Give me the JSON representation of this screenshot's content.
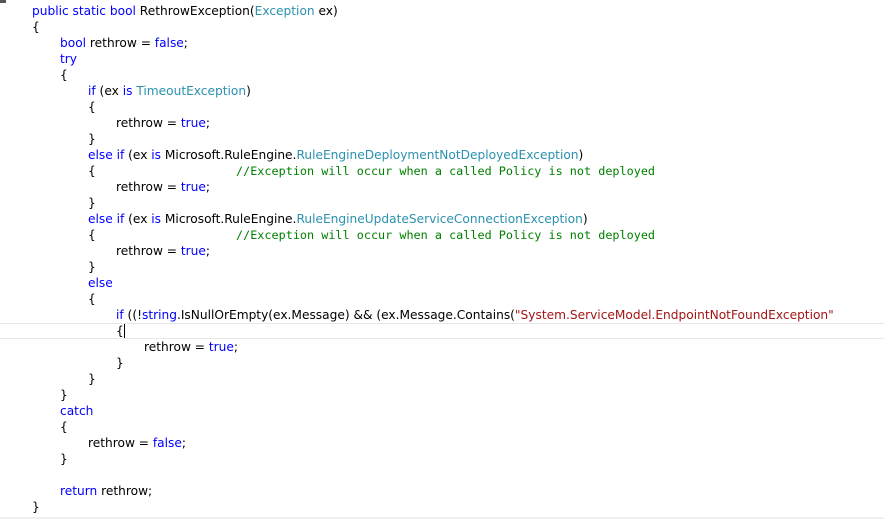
{
  "editor": {
    "colors": {
      "background": "#ffffff",
      "keyword": "#0000ff",
      "type": "#2b91af",
      "comment": "#008000",
      "string": "#a31515",
      "plain": "#000000"
    },
    "lines": [
      {
        "segs": [
          {
            "t": "public",
            "c": "keyword"
          },
          {
            "t": " "
          },
          {
            "t": "static",
            "c": "keyword"
          },
          {
            "t": " "
          },
          {
            "t": "bool",
            "c": "keyword"
          },
          {
            "t": " RethrowException("
          },
          {
            "t": "Exception",
            "c": "type"
          },
          {
            "t": " ex)"
          }
        ]
      },
      {
        "segs": [
          {
            "t": "{"
          }
        ]
      },
      {
        "segs": [
          {
            "t": "bool",
            "c": "keyword"
          },
          {
            "t": " rethrow = "
          },
          {
            "t": "false",
            "c": "keyword"
          },
          {
            "t": ";"
          }
        ]
      },
      {
        "segs": [
          {
            "t": "try",
            "c": "keyword"
          }
        ]
      },
      {
        "segs": [
          {
            "t": "{"
          }
        ]
      },
      {
        "segs": [
          {
            "t": "if",
            "c": "keyword"
          },
          {
            "t": " (ex "
          },
          {
            "t": "is",
            "c": "keyword"
          },
          {
            "t": " "
          },
          {
            "t": "TimeoutException",
            "c": "type"
          },
          {
            "t": ")"
          }
        ]
      },
      {
        "segs": [
          {
            "t": "{"
          }
        ]
      },
      {
        "segs": [
          {
            "t": "rethrow = "
          },
          {
            "t": "true",
            "c": "keyword"
          },
          {
            "t": ";"
          }
        ]
      },
      {
        "segs": [
          {
            "t": "}"
          }
        ]
      },
      {
        "segs": [
          {
            "t": "else",
            "c": "keyword"
          },
          {
            "t": " "
          },
          {
            "t": "if",
            "c": "keyword"
          },
          {
            "t": " (ex "
          },
          {
            "t": "is",
            "c": "keyword"
          },
          {
            "t": " Microsoft.RuleEngine."
          },
          {
            "t": "RuleEngineDeploymentNotDeployedException",
            "c": "type"
          },
          {
            "t": ")"
          }
        ]
      },
      {
        "segs": [
          {
            "t": "{"
          }
        ],
        "comment": "//Exception will occur when a called Policy is not deployed"
      },
      {
        "segs": [
          {
            "t": "rethrow = "
          },
          {
            "t": "true",
            "c": "keyword"
          },
          {
            "t": ";"
          }
        ]
      },
      {
        "segs": [
          {
            "t": "}"
          }
        ]
      },
      {
        "segs": [
          {
            "t": "else",
            "c": "keyword"
          },
          {
            "t": " "
          },
          {
            "t": "if",
            "c": "keyword"
          },
          {
            "t": " (ex "
          },
          {
            "t": "is",
            "c": "keyword"
          },
          {
            "t": " Microsoft.RuleEngine."
          },
          {
            "t": "RuleEngineUpdateServiceConnectionException",
            "c": "type"
          },
          {
            "t": ")"
          }
        ]
      },
      {
        "segs": [
          {
            "t": "{"
          }
        ],
        "comment": "//Exception will occur when a called Policy is not deployed"
      },
      {
        "segs": [
          {
            "t": "rethrow = "
          },
          {
            "t": "true",
            "c": "keyword"
          },
          {
            "t": ";"
          }
        ]
      },
      {
        "segs": [
          {
            "t": "}"
          }
        ]
      },
      {
        "segs": [
          {
            "t": "else",
            "c": "keyword"
          }
        ]
      },
      {
        "segs": [
          {
            "t": "{"
          }
        ]
      },
      {
        "segs": [
          {
            "t": "if",
            "c": "keyword"
          },
          {
            "t": " ((!"
          },
          {
            "t": "string",
            "c": "keyword"
          },
          {
            "t": ".IsNullOrEmpty(ex.Message) && (ex.Message.Contains("
          },
          {
            "t": "\"System.ServiceModel.EndpointNotFoundException\"",
            "c": "string"
          }
        ]
      },
      {
        "segs": [
          {
            "t": "{"
          }
        ]
      },
      {
        "segs": [
          {
            "t": "rethrow = "
          },
          {
            "t": "true",
            "c": "keyword"
          },
          {
            "t": ";"
          }
        ]
      },
      {
        "segs": [
          {
            "t": "}"
          }
        ]
      },
      {
        "segs": [
          {
            "t": "}"
          }
        ]
      },
      {
        "segs": [
          {
            "t": "}"
          }
        ]
      },
      {
        "segs": [
          {
            "t": "catch",
            "c": "keyword"
          }
        ]
      },
      {
        "segs": [
          {
            "t": "{"
          }
        ]
      },
      {
        "segs": [
          {
            "t": "rethrow = "
          },
          {
            "t": "false",
            "c": "keyword"
          },
          {
            "t": ";"
          }
        ]
      },
      {
        "segs": [
          {
            "t": "}"
          }
        ]
      },
      {
        "segs": []
      },
      {
        "segs": [
          {
            "t": "return",
            "c": "keyword"
          },
          {
            "t": " rethrow;"
          }
        ]
      },
      {
        "segs": [
          {
            "t": "}"
          }
        ]
      }
    ]
  }
}
